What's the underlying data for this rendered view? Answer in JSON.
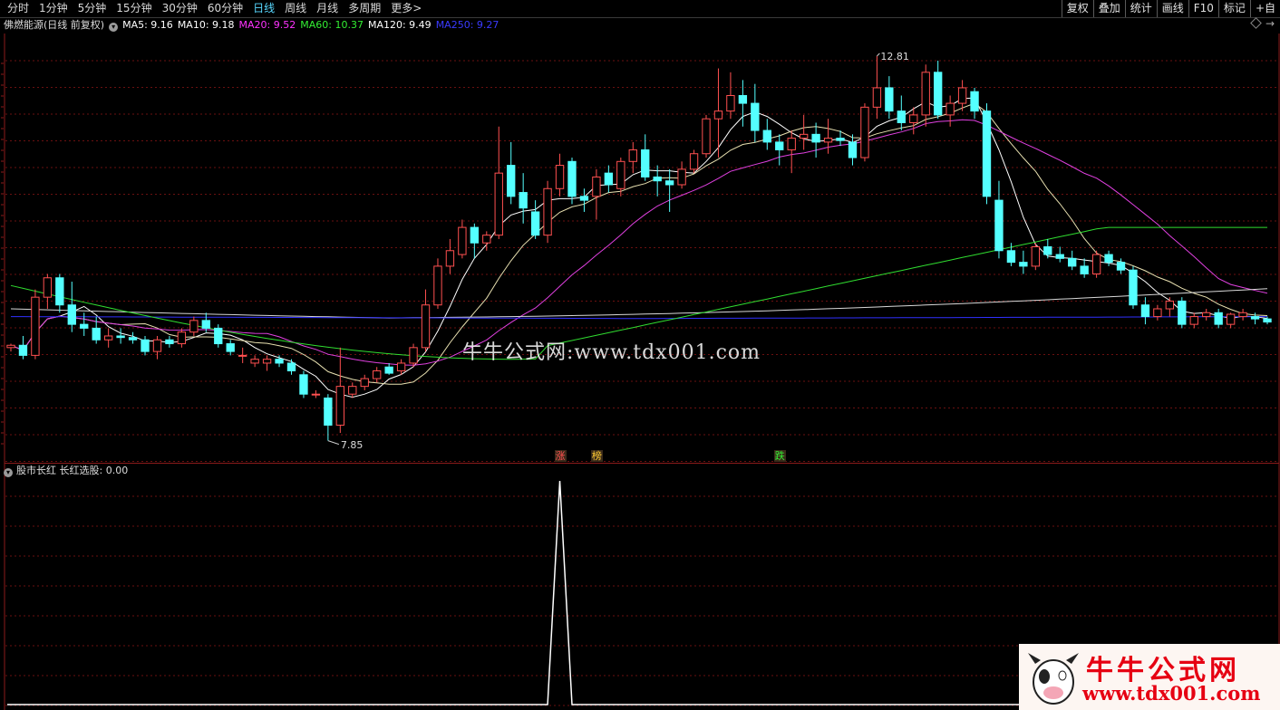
{
  "toolbar": {
    "periods": [
      "分时",
      "1分钟",
      "5分钟",
      "15分钟",
      "30分钟",
      "60分钟",
      "日线",
      "周线",
      "月线",
      "多周期",
      "更多>"
    ],
    "active": "日线",
    "right_buttons": [
      "复权",
      "叠加",
      "统计",
      "画线",
      "F10",
      "标记",
      "+自"
    ]
  },
  "info": {
    "stock": "佛燃能源(日线 前复权)",
    "ma": [
      {
        "label": "MA5: 9.16",
        "color": "#ffffff"
      },
      {
        "label": "MA10: 9.18",
        "color": "#ffffff"
      },
      {
        "label": "MA20: 9.52",
        "color": "#ff33ff"
      },
      {
        "label": "MA60: 10.37",
        "color": "#33ee33"
      },
      {
        "label": "MA120: 9.49",
        "color": "#ffffff"
      },
      {
        "label": "MA250: 9.27",
        "color": "#3a3aff"
      }
    ]
  },
  "price_annotations": {
    "high": "12.81",
    "low": "7.85"
  },
  "events": [
    {
      "label": "涨",
      "color": "#ff5050"
    },
    {
      "label": "榜",
      "color": "#ffcc33"
    },
    {
      "label": "跌",
      "color": "#33ee33"
    }
  ],
  "indicator": {
    "label": "股市长红  长红选股: 0.00"
  },
  "watermark": "牛牛公式网:www.tdx001.com",
  "logo": {
    "title": "牛牛公式网",
    "url": "www.tdx001.com"
  },
  "chart_data": {
    "type": "candlestick",
    "candles": [
      [
        9.05,
        9.1,
        9.0,
        9.08
      ],
      [
        9.08,
        9.2,
        8.9,
        8.95
      ],
      [
        8.95,
        9.8,
        8.9,
        9.7
      ],
      [
        9.7,
        10.0,
        9.55,
        9.95
      ],
      [
        9.95,
        10.0,
        9.5,
        9.6
      ],
      [
        9.6,
        9.9,
        9.25,
        9.35
      ],
      [
        9.35,
        9.5,
        9.2,
        9.3
      ],
      [
        9.3,
        9.45,
        9.1,
        9.15
      ],
      [
        9.15,
        9.3,
        9.05,
        9.2
      ],
      [
        9.2,
        9.3,
        9.1,
        9.18
      ],
      [
        9.18,
        9.25,
        9.1,
        9.15
      ],
      [
        9.15,
        9.2,
        8.95,
        9.0
      ],
      [
        9.0,
        9.2,
        8.9,
        9.15
      ],
      [
        9.15,
        9.2,
        9.05,
        9.1
      ],
      [
        9.1,
        9.3,
        9.05,
        9.25
      ],
      [
        9.25,
        9.45,
        9.2,
        9.4
      ],
      [
        9.4,
        9.5,
        9.25,
        9.3
      ],
      [
        9.3,
        9.35,
        9.05,
        9.1
      ],
      [
        9.1,
        9.15,
        8.95,
        9.0
      ],
      [
        8.95,
        9.05,
        8.85,
        8.95
      ],
      [
        8.85,
        8.95,
        8.8,
        8.9
      ],
      [
        8.85,
        8.95,
        8.75,
        8.9
      ],
      [
        8.9,
        8.95,
        8.8,
        8.85
      ],
      [
        8.85,
        8.9,
        8.7,
        8.75
      ],
      [
        8.7,
        8.75,
        8.4,
        8.45
      ],
      [
        8.45,
        8.5,
        8.4,
        8.45
      ],
      [
        8.4,
        8.45,
        7.85,
        8.05
      ],
      [
        8.05,
        9.05,
        7.95,
        8.55
      ],
      [
        8.45,
        8.6,
        8.4,
        8.55
      ],
      [
        8.55,
        8.7,
        8.5,
        8.65
      ],
      [
        8.65,
        8.8,
        8.6,
        8.75
      ],
      [
        8.8,
        8.85,
        8.7,
        8.72
      ],
      [
        8.75,
        8.9,
        8.7,
        8.85
      ],
      [
        8.85,
        9.1,
        8.8,
        9.05
      ],
      [
        9.05,
        9.8,
        9.0,
        9.6
      ],
      [
        9.6,
        10.2,
        9.55,
        10.1
      ],
      [
        10.1,
        10.45,
        10.0,
        10.3
      ],
      [
        10.25,
        10.7,
        10.2,
        10.6
      ],
      [
        10.6,
        10.65,
        10.2,
        10.4
      ],
      [
        10.4,
        10.55,
        10.3,
        10.5
      ],
      [
        10.5,
        11.9,
        10.45,
        11.3
      ],
      [
        11.4,
        11.7,
        10.9,
        11.0
      ],
      [
        11.05,
        11.3,
        10.65,
        10.85
      ],
      [
        10.8,
        10.95,
        10.45,
        10.5
      ],
      [
        10.5,
        11.2,
        10.4,
        11.1
      ],
      [
        11.1,
        11.55,
        11.0,
        11.4
      ],
      [
        11.45,
        11.5,
        10.9,
        11.0
      ],
      [
        11.0,
        11.1,
        10.8,
        10.95
      ],
      [
        11.0,
        11.35,
        10.7,
        11.25
      ],
      [
        11.3,
        11.4,
        11.05,
        11.15
      ],
      [
        11.1,
        11.5,
        11.0,
        11.45
      ],
      [
        11.45,
        11.7,
        11.3,
        11.6
      ],
      [
        11.6,
        11.8,
        11.2,
        11.25
      ],
      [
        11.25,
        11.4,
        11.0,
        11.2
      ],
      [
        11.2,
        11.35,
        10.8,
        11.15
      ],
      [
        11.15,
        11.45,
        11.1,
        11.35
      ],
      [
        11.35,
        11.6,
        11.3,
        11.55
      ],
      [
        11.55,
        12.05,
        11.5,
        12.0
      ],
      [
        12.0,
        12.65,
        11.5,
        12.1
      ],
      [
        12.1,
        12.6,
        12.0,
        12.3
      ],
      [
        12.3,
        12.5,
        11.9,
        12.2
      ],
      [
        12.2,
        12.45,
        11.7,
        11.85
      ],
      [
        11.85,
        12.0,
        11.6,
        11.7
      ],
      [
        11.7,
        11.8,
        11.4,
        11.6
      ],
      [
        11.6,
        11.85,
        11.3,
        11.75
      ],
      [
        11.75,
        12.05,
        11.6,
        11.8
      ],
      [
        11.8,
        11.95,
        11.5,
        11.7
      ],
      [
        11.7,
        12.0,
        11.55,
        11.75
      ],
      [
        11.75,
        11.85,
        11.65,
        11.72
      ],
      [
        11.7,
        11.8,
        11.4,
        11.5
      ],
      [
        11.5,
        12.2,
        11.45,
        12.15
      ],
      [
        12.15,
        12.81,
        12.0,
        12.4
      ],
      [
        12.4,
        12.55,
        12.0,
        12.1
      ],
      [
        12.1,
        12.3,
        11.85,
        11.95
      ],
      [
        11.95,
        12.15,
        11.8,
        12.05
      ],
      [
        12.05,
        12.7,
        11.9,
        12.6
      ],
      [
        12.6,
        12.75,
        12.0,
        12.05
      ],
      [
        12.05,
        12.3,
        11.9,
        12.2
      ],
      [
        12.2,
        12.5,
        12.1,
        12.4
      ],
      [
        12.35,
        12.4,
        12.0,
        12.1
      ],
      [
        12.1,
        12.2,
        10.9,
        11.0
      ],
      [
        10.95,
        11.2,
        10.2,
        10.3
      ],
      [
        10.3,
        10.4,
        10.1,
        10.15
      ],
      [
        10.15,
        10.3,
        10.0,
        10.1
      ],
      [
        10.1,
        10.4,
        10.05,
        10.35
      ],
      [
        10.35,
        10.45,
        10.2,
        10.25
      ],
      [
        10.25,
        10.35,
        10.15,
        10.2
      ],
      [
        10.2,
        10.3,
        10.05,
        10.1
      ],
      [
        10.1,
        10.2,
        9.95,
        10.0
      ],
      [
        10.0,
        10.3,
        9.95,
        10.25
      ],
      [
        10.25,
        10.3,
        10.1,
        10.15
      ],
      [
        10.15,
        10.2,
        10.0,
        10.05
      ],
      [
        10.05,
        10.1,
        9.55,
        9.6
      ],
      [
        9.6,
        9.7,
        9.35,
        9.45
      ],
      [
        9.45,
        9.6,
        9.4,
        9.55
      ],
      [
        9.55,
        9.7,
        9.45,
        9.65
      ],
      [
        9.65,
        9.7,
        9.3,
        9.35
      ],
      [
        9.35,
        9.5,
        9.3,
        9.45
      ],
      [
        9.45,
        9.55,
        9.4,
        9.5
      ],
      [
        9.5,
        9.55,
        9.3,
        9.35
      ],
      [
        9.35,
        9.5,
        9.3,
        9.48
      ],
      [
        9.45,
        9.55,
        9.4,
        9.5
      ],
      [
        9.45,
        9.5,
        9.35,
        9.42
      ],
      [
        9.42,
        9.45,
        9.35,
        9.38
      ]
    ],
    "signal": {
      "peak_value": 1,
      "baseline": 0,
      "peak_index": 45
    },
    "event_indices": [
      45,
      48,
      63
    ]
  }
}
